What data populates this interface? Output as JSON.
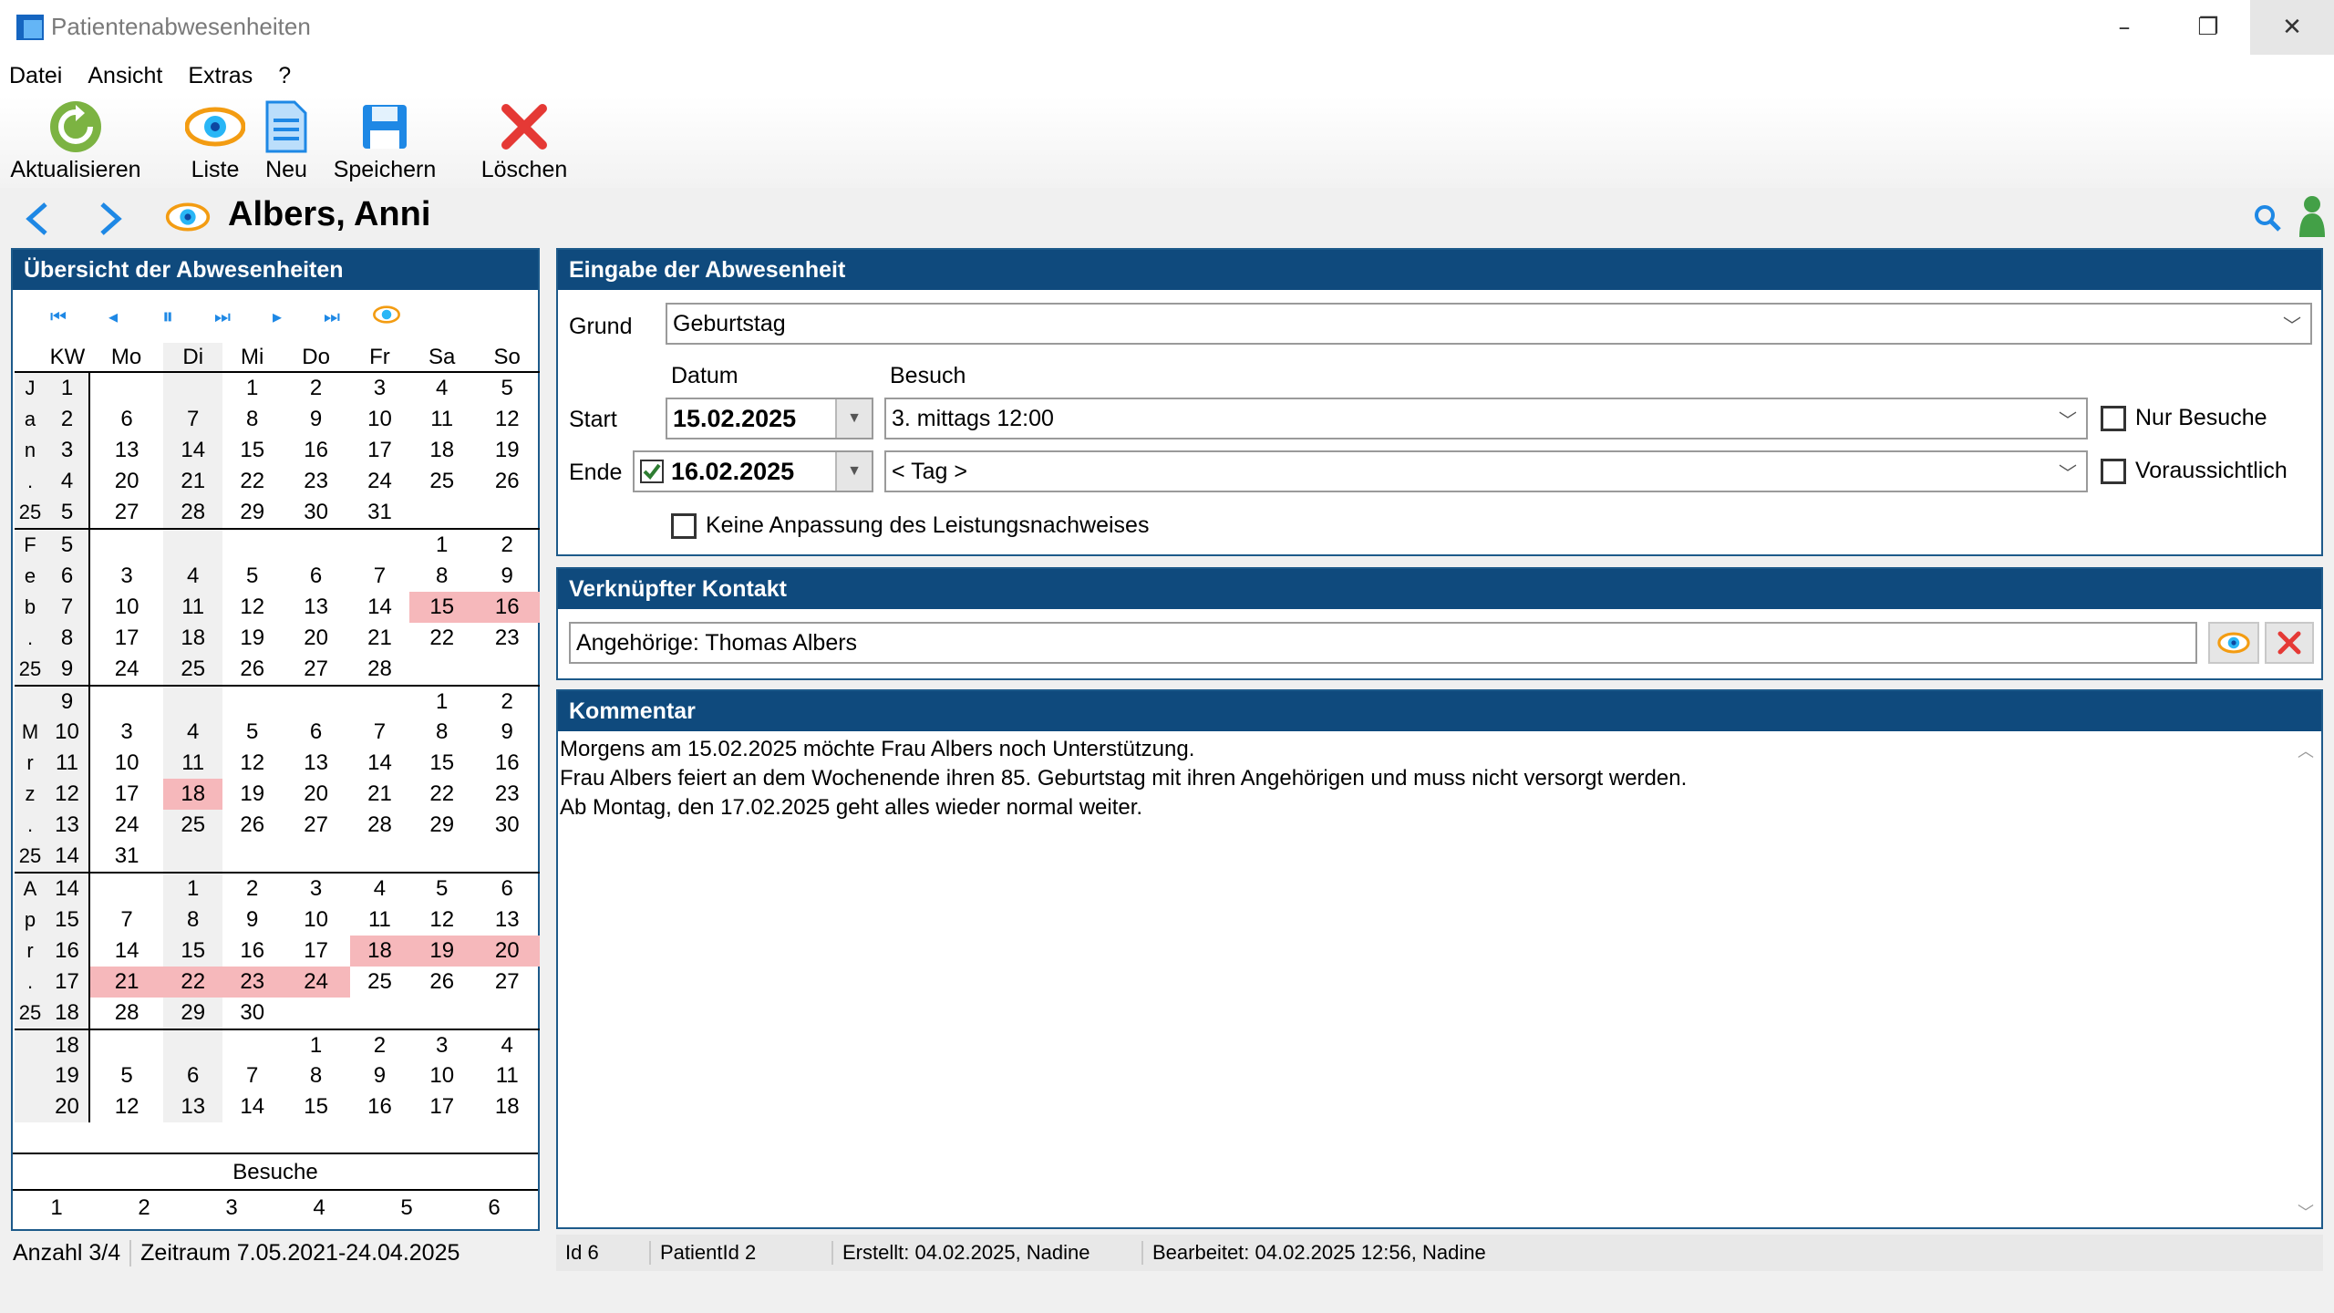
{
  "window": {
    "title": "Patientenabwesenheiten",
    "minimize": "–",
    "restore": "❐",
    "close": "✕"
  },
  "menu": [
    "Datei",
    "Ansicht",
    "Extras",
    "?"
  ],
  "toolbar": {
    "refresh": "Aktualisieren",
    "list": "Liste",
    "new": "Neu",
    "save": "Speichern",
    "delete": "Löschen"
  },
  "patient": {
    "name": "Albers, Anni"
  },
  "overview": {
    "title": "Übersicht der Abwesenheiten",
    "headers": [
      "KW",
      "Mo",
      "Di",
      "Mi",
      "Do",
      "Fr",
      "Sa",
      "So"
    ],
    "visits_label": "Besuche",
    "visits": [
      "1",
      "2",
      "3",
      "4",
      "5",
      "6"
    ]
  },
  "status_left": {
    "count": "Anzahl 3/4",
    "range": "Zeitraum 7.05.2021-24.04.2025"
  },
  "entry": {
    "title": "Eingabe der Abwesenheit",
    "grund_label": "Grund",
    "grund_value": "Geburtstag",
    "datum_label": "Datum",
    "besuch_label": "Besuch",
    "start_label": "Start",
    "start_date": "15.02.2025",
    "start_visit": "3. mittags 12:00",
    "end_label": "Ende",
    "end_date": "16.02.2025",
    "end_visit": "< Tag >",
    "only_visits": "Nur Besuche",
    "expected": "Voraussichtlich",
    "no_adjust": "Keine Anpassung des Leistungsnachweises"
  },
  "contact": {
    "title": "Verknüpfter Kontakt",
    "value": "Angehörige: Thomas Albers"
  },
  "comment": {
    "title": "Kommentar",
    "lines": [
      "Morgens am 15.02.2025 möchte Frau Albers noch Unterstützung.",
      "Frau Albers feiert an dem Wochenende ihren 85. Geburtstag mit ihren Angehörigen und muss nicht versorgt werden.",
      "Ab Montag, den 17.02.2025 geht alles wieder normal weiter."
    ]
  },
  "status_right": {
    "id": "Id 6",
    "patient_id": "PatientId 2",
    "created": "Erstellt: 04.02.2025, Nadine",
    "edited": "Bearbeitet: 04.02.2025 12:56, Nadine"
  },
  "calendar": [
    {
      "month": "J",
      "kw": "1",
      "days": [
        "",
        "",
        "1",
        "2",
        "3",
        "4",
        "5"
      ],
      "start": true
    },
    {
      "month": "a",
      "kw": "2",
      "days": [
        "6",
        "7",
        "8",
        "9",
        "10",
        "11",
        "12"
      ]
    },
    {
      "month": "n",
      "kw": "3",
      "days": [
        "13",
        "14",
        "15",
        "16",
        "17",
        "18",
        "19"
      ]
    },
    {
      "month": ".",
      "kw": "4",
      "days": [
        "20",
        "21",
        "22",
        "23",
        "24",
        "25",
        "26"
      ]
    },
    {
      "month": "25",
      "kw": "5",
      "days": [
        "27",
        "28",
        "29",
        "30",
        "31",
        "",
        ""
      ]
    },
    {
      "month": "F",
      "kw": "5",
      "days": [
        "",
        "",
        "",
        "",
        "",
        "1",
        "2"
      ],
      "start": true
    },
    {
      "month": "e",
      "kw": "6",
      "days": [
        "3",
        "4",
        "5",
        "6",
        "7",
        "8",
        "9"
      ],
      "current": true
    },
    {
      "month": "b",
      "kw": "7",
      "days": [
        "10",
        "11",
        "12",
        "13",
        "14",
        "15",
        "16"
      ],
      "sel": [
        5,
        6
      ]
    },
    {
      "month": ".",
      "kw": "8",
      "days": [
        "17",
        "18",
        "19",
        "20",
        "21",
        "22",
        "23"
      ]
    },
    {
      "month": "25",
      "kw": "9",
      "days": [
        "24",
        "25",
        "26",
        "27",
        "28",
        "",
        ""
      ]
    },
    {
      "month": "",
      "kw": "9",
      "days": [
        "",
        "",
        "",
        "",
        "",
        "1",
        "2"
      ],
      "start": true
    },
    {
      "month": "M",
      "kw": "10",
      "days": [
        "3",
        "4",
        "5",
        "6",
        "7",
        "8",
        "9"
      ]
    },
    {
      "month": "r",
      "kw": "11",
      "days": [
        "10",
        "11",
        "12",
        "13",
        "14",
        "15",
        "16"
      ]
    },
    {
      "month": "z",
      "kw": "12",
      "days": [
        "17",
        "18",
        "19",
        "20",
        "21",
        "22",
        "23"
      ],
      "sel": [
        1
      ]
    },
    {
      "month": ".",
      "kw": "13",
      "days": [
        "24",
        "25",
        "26",
        "27",
        "28",
        "29",
        "30"
      ]
    },
    {
      "month": "25",
      "kw": "14",
      "days": [
        "31",
        "",
        "",
        "",
        "",
        "",
        ""
      ]
    },
    {
      "month": "A",
      "kw": "14",
      "days": [
        "",
        "1",
        "2",
        "3",
        "4",
        "5",
        "6"
      ],
      "start": true
    },
    {
      "month": "p",
      "kw": "15",
      "days": [
        "7",
        "8",
        "9",
        "10",
        "11",
        "12",
        "13"
      ]
    },
    {
      "month": "r",
      "kw": "16",
      "days": [
        "14",
        "15",
        "16",
        "17",
        "18",
        "19",
        "20"
      ],
      "sel": [
        4,
        5,
        6
      ]
    },
    {
      "month": ".",
      "kw": "17",
      "days": [
        "21",
        "22",
        "23",
        "24",
        "25",
        "26",
        "27"
      ],
      "sel": [
        0,
        1,
        2,
        3
      ]
    },
    {
      "month": "25",
      "kw": "18",
      "days": [
        "28",
        "29",
        "30",
        "",
        "",
        "",
        ""
      ]
    },
    {
      "month": "",
      "kw": "18",
      "days": [
        "",
        "",
        "",
        "1",
        "2",
        "3",
        "4"
      ],
      "start": true
    },
    {
      "month": "",
      "kw": "19",
      "days": [
        "5",
        "6",
        "7",
        "8",
        "9",
        "10",
        "11"
      ]
    },
    {
      "month": "",
      "kw": "20",
      "days": [
        "12",
        "13",
        "14",
        "15",
        "16",
        "17",
        "18"
      ]
    }
  ],
  "colors": {
    "header": "#0f4a7d",
    "selected": "#f6b8bb",
    "accent": "#1e88e5"
  }
}
